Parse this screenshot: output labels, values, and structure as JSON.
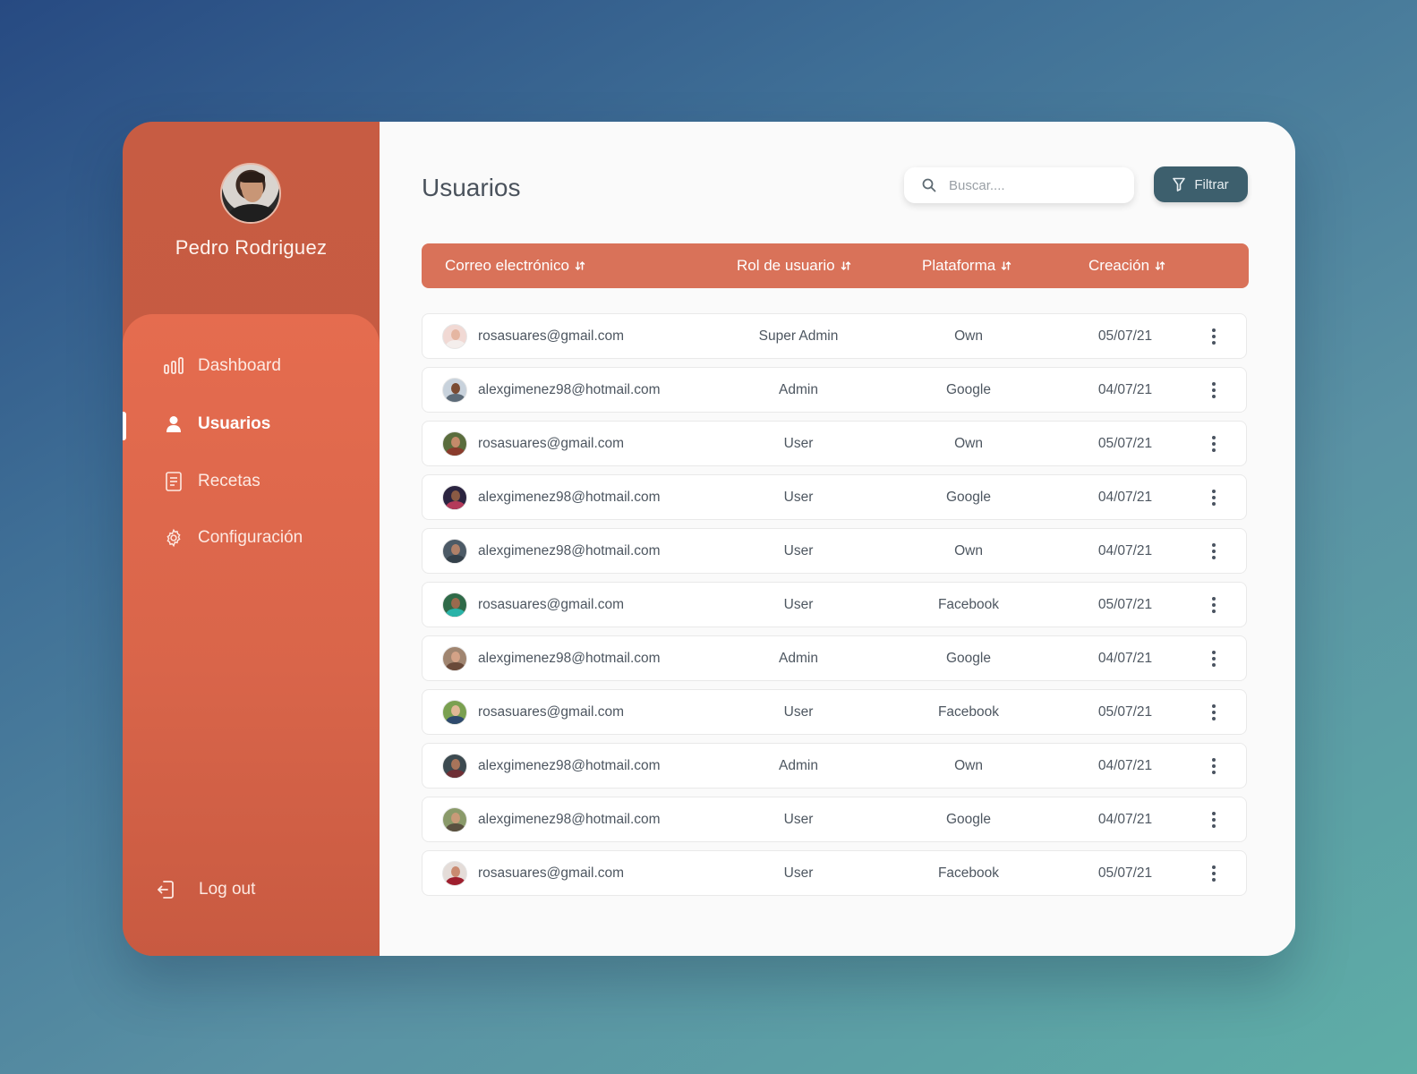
{
  "profile": {
    "name": "Pedro Rodriguez"
  },
  "nav": {
    "items": [
      {
        "label": "Dashboard",
        "icon": "bar-chart-icon"
      },
      {
        "label": "Usuarios",
        "icon": "user-icon"
      },
      {
        "label": "Recetas",
        "icon": "document-icon"
      },
      {
        "label": "Configuración",
        "icon": "gear-icon"
      }
    ],
    "logout": "Log out"
  },
  "header": {
    "title": "Usuarios",
    "search_placeholder": "Buscar....",
    "filter_label": "Filtrar"
  },
  "table": {
    "columns": [
      "Correo electrónico",
      "Rol de usuario",
      "Plataforma",
      "Creación"
    ],
    "rows": [
      {
        "email": "rosasuares@gmail.com",
        "role": "Super Admin",
        "platform": "Own",
        "created": "05/07/21"
      },
      {
        "email": "alexgimenez98@hotmail.com",
        "role": "Admin",
        "platform": "Google",
        "created": "04/07/21"
      },
      {
        "email": "rosasuares@gmail.com",
        "role": "User",
        "platform": "Own",
        "created": "05/07/21"
      },
      {
        "email": "alexgimenez98@hotmail.com",
        "role": "User",
        "platform": "Google",
        "created": "04/07/21"
      },
      {
        "email": "alexgimenez98@hotmail.com",
        "role": "User",
        "platform": "Own",
        "created": "04/07/21"
      },
      {
        "email": "rosasuares@gmail.com",
        "role": "User",
        "platform": "Facebook",
        "created": "05/07/21"
      },
      {
        "email": "alexgimenez98@hotmail.com",
        "role": "Admin",
        "platform": "Google",
        "created": "04/07/21"
      },
      {
        "email": "rosasuares@gmail.com",
        "role": "User",
        "platform": "Facebook",
        "created": "05/07/21"
      },
      {
        "email": "alexgimenez98@hotmail.com",
        "role": "Admin",
        "platform": "Own",
        "created": "04/07/21"
      },
      {
        "email": "alexgimenez98@hotmail.com",
        "role": "User",
        "platform": "Google",
        "created": "04/07/21"
      },
      {
        "email": "rosasuares@gmail.com",
        "role": "User",
        "platform": "Facebook",
        "created": "05/07/21"
      }
    ]
  },
  "colors": {
    "sidebar_top": "#c75c43",
    "sidebar_nav": "#e56c4f",
    "table_header": "#d97259",
    "filter_button": "#3d5f6d"
  }
}
